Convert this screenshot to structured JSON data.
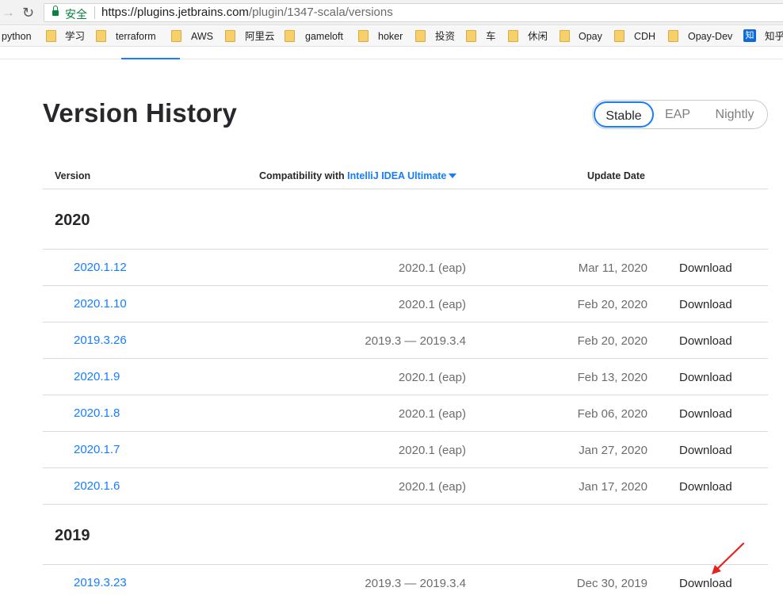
{
  "browser": {
    "secure_label": "安全",
    "url_host": "https://plugins.jetbrains.com",
    "url_path": "/plugin/1347-scala/versions"
  },
  "bookmarks": [
    {
      "label": "python",
      "icon": "none"
    },
    {
      "label": "学习",
      "icon": "folder-icon"
    },
    {
      "label": "terraform",
      "icon": "folder-icon"
    },
    {
      "label": "AWS",
      "icon": "folder-icon"
    },
    {
      "label": "阿里云",
      "icon": "folder-icon"
    },
    {
      "label": "gameloft",
      "icon": "folder-icon"
    },
    {
      "label": "hoker",
      "icon": "folder-icon"
    },
    {
      "label": "投资",
      "icon": "folder-icon"
    },
    {
      "label": "车",
      "icon": "folder-icon"
    },
    {
      "label": "休闲",
      "icon": "folder-icon"
    },
    {
      "label": "Opay",
      "icon": "folder-icon"
    },
    {
      "label": "CDH",
      "icon": "folder-icon"
    },
    {
      "label": "Opay-Dev",
      "icon": "folder-icon"
    },
    {
      "label": "知乎",
      "icon": "zhihu-icon",
      "icon_text": "知"
    }
  ],
  "page": {
    "title": "Version History",
    "channels": [
      "Stable",
      "EAP",
      "Nightly"
    ],
    "active_channel": "Stable",
    "table_header": {
      "version": "Version",
      "compat_prefix": "Compatibility with",
      "compat_product": "IntelliJ IDEA Ultimate",
      "update_date": "Update Date"
    },
    "groups": [
      {
        "year": "2020",
        "rows": [
          {
            "version": "2020.1.12",
            "compat": "2020.1 (eap)",
            "date": "Mar 11, 2020",
            "action": "Download"
          },
          {
            "version": "2020.1.10",
            "compat": "2020.1 (eap)",
            "date": "Feb 20, 2020",
            "action": "Download"
          },
          {
            "version": "2019.3.26",
            "compat": "2019.3 — 2019.3.4",
            "date": "Feb 20, 2020",
            "action": "Download"
          },
          {
            "version": "2020.1.9",
            "compat": "2020.1 (eap)",
            "date": "Feb 13, 2020",
            "action": "Download"
          },
          {
            "version": "2020.1.8",
            "compat": "2020.1 (eap)",
            "date": "Feb 06, 2020",
            "action": "Download"
          },
          {
            "version": "2020.1.7",
            "compat": "2020.1 (eap)",
            "date": "Jan 27, 2020",
            "action": "Download"
          },
          {
            "version": "2020.1.6",
            "compat": "2020.1 (eap)",
            "date": "Jan 17, 2020",
            "action": "Download"
          }
        ]
      },
      {
        "year": "2019",
        "rows": [
          {
            "version": "2019.3.23",
            "compat": "2019.3 — 2019.3.4",
            "date": "Dec 30, 2019",
            "action": "Download"
          }
        ]
      }
    ]
  },
  "colors": {
    "accent": "#167dff",
    "annotation": "#e8221b",
    "secure": "#0b8043"
  }
}
